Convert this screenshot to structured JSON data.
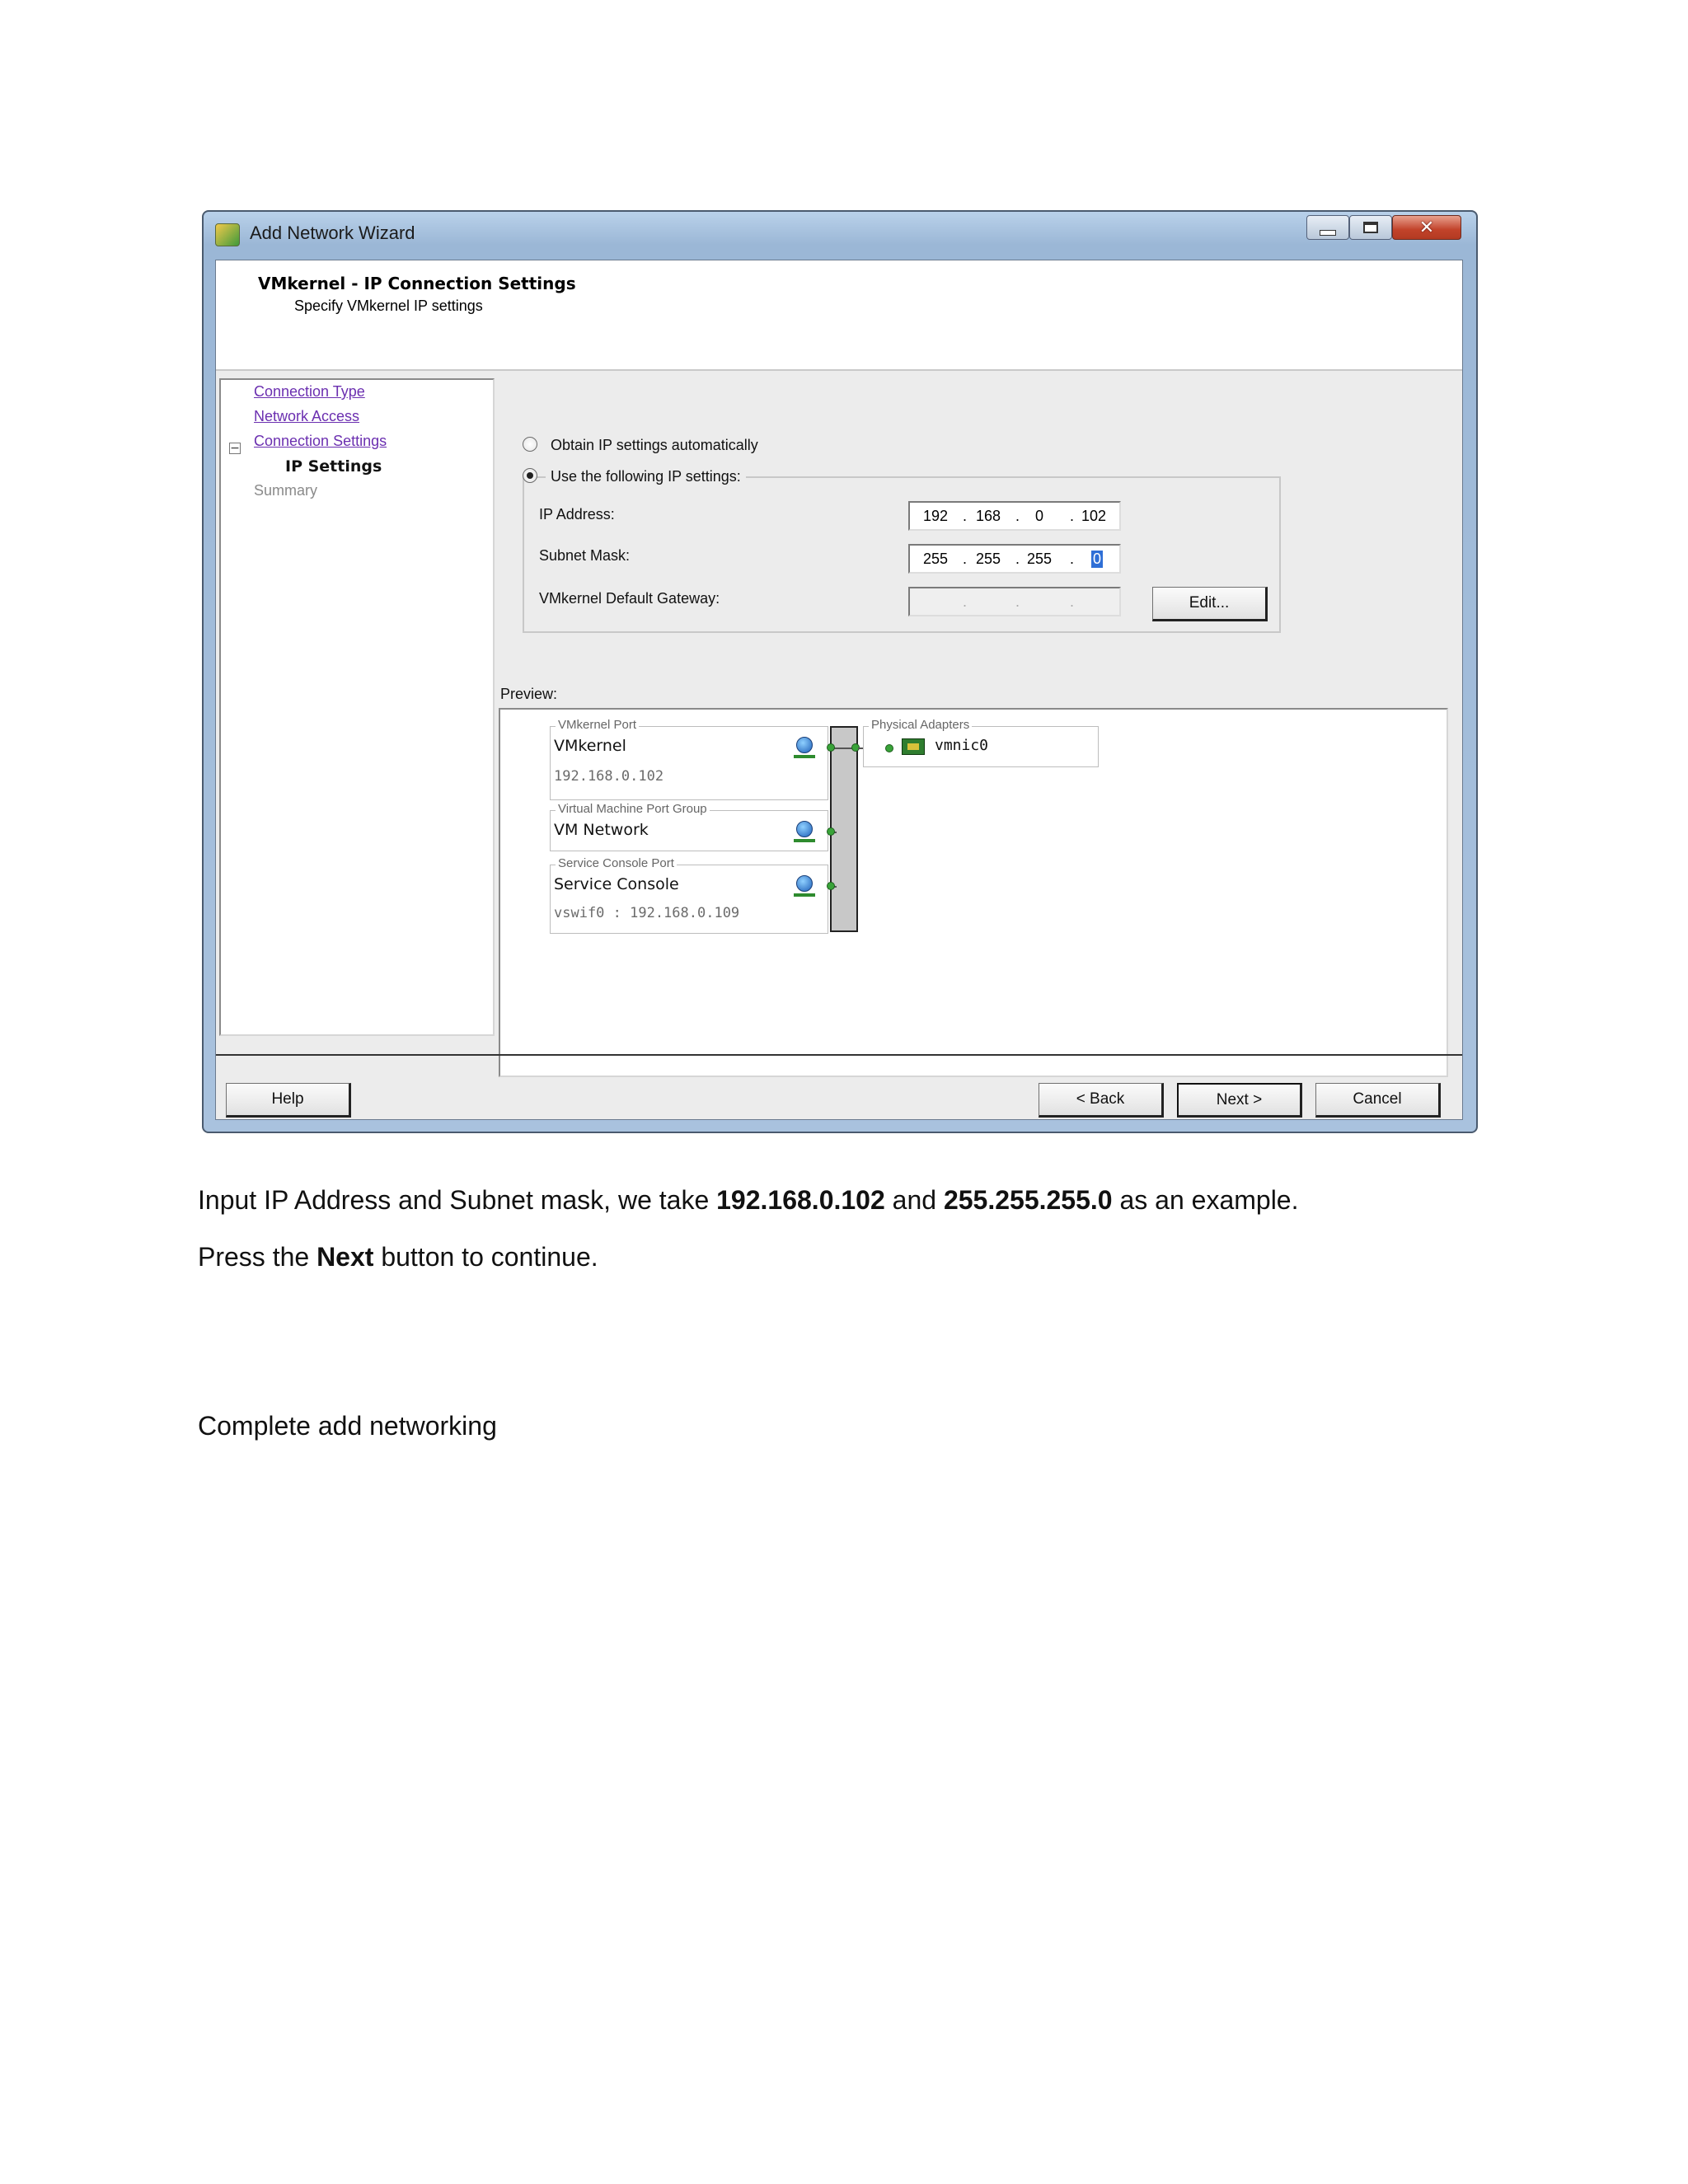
{
  "window": {
    "title": "Add Network Wizard",
    "close_glyph": "✕",
    "header_title": "VMkernel - IP Connection Settings",
    "header_subtitle": "Specify VMkernel IP settings"
  },
  "nav": {
    "items": [
      {
        "label": "Connection Type",
        "state": "link"
      },
      {
        "label": "Network Access",
        "state": "link"
      },
      {
        "label": "Connection Settings",
        "state": "link-expanded"
      },
      {
        "label": "IP Settings",
        "state": "current"
      },
      {
        "label": "Summary",
        "state": "disabled"
      }
    ],
    "collapse_glyph": "−"
  },
  "ip_settings": {
    "option_auto": "Obtain IP settings automatically",
    "option_manual": "Use the following IP settings:",
    "selected": "manual",
    "ip_label": "IP Address:",
    "ip_octets": [
      "192",
      "168",
      "0",
      "102"
    ],
    "mask_label": "Subnet Mask:",
    "mask_octets": [
      "255",
      "255",
      "255",
      "0"
    ],
    "gateway_label": "VMkernel Default Gateway:",
    "gateway_octets": [
      "",
      "",
      "",
      ""
    ],
    "edit_button": "Edit..."
  },
  "preview": {
    "label": "Preview:",
    "port_groups": [
      {
        "legend": "VMkernel Port",
        "name": "VMkernel",
        "detail": "192.168.0.102"
      },
      {
        "legend": "Virtual Machine Port Group",
        "name": "VM Network",
        "detail": ""
      },
      {
        "legend": "Service Console Port",
        "name": "Service Console",
        "detail": "vswif0 : 192.168.0.109"
      }
    ],
    "adapters_legend": "Physical Adapters",
    "adapter": "vmnic0"
  },
  "buttons": {
    "help": "Help",
    "back": "< Back",
    "next": "Next >",
    "cancel": "Cancel"
  },
  "document": {
    "line1_a": "Input IP Address and Subnet mask, we take ",
    "line1_b": "192.168.0.102",
    "line1_c": " and ",
    "line1_d": "255.255.255.0",
    "line1_e": " as an example.",
    "line2_a": "Press the ",
    "line2_b": "Next",
    "line2_c": " button to continue.",
    "line3": "Complete add networking"
  },
  "colors": {
    "link": "#6b2fb0",
    "title_bar": "#b9d1ea",
    "close_button": "#c2432a",
    "selection": "#2f6fd6",
    "switch_port": "#39a339"
  }
}
